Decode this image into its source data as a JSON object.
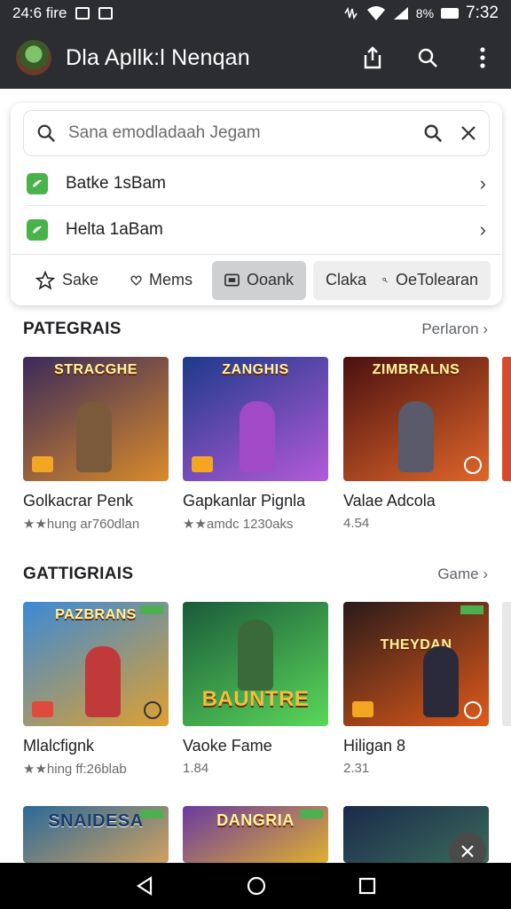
{
  "status_bar": {
    "left_text": "24:6 fire",
    "battery_text": "8%",
    "time": "7:32"
  },
  "app_bar": {
    "title": "Dla Apllk:l Nenqan",
    "icons": [
      "share-icon",
      "search-icon",
      "more-vert-icon"
    ]
  },
  "search": {
    "query": "Sana emodladaah Jegam",
    "suggestions": [
      {
        "label": "Batke 1sBam"
      },
      {
        "label": "Helta 1aBam"
      }
    ],
    "chips": [
      {
        "label": "Sake",
        "icon": "star-icon"
      },
      {
        "label": "Mems",
        "icon": "heart-icon"
      },
      {
        "label": "Ooank",
        "icon": "cast-icon",
        "active": true
      },
      {
        "label": "Claka"
      },
      {
        "label": "OeTolearan",
        "icon": "link-icon"
      }
    ]
  },
  "sections": [
    {
      "title": "PATEGRAIS",
      "link": "Perlaron",
      "items": [
        {
          "banner": "STRACGHE",
          "name": "Golkacrar Penk",
          "meta": "★★hung ar760dlan",
          "colors": [
            "#3a2a5a",
            "#d98a2b"
          ]
        },
        {
          "banner": "ZANGHIS",
          "name": "Gapkanlar Pignla",
          "meta": "★★amdc 1230aks",
          "colors": [
            "#1c3a8a",
            "#b45ad8"
          ]
        },
        {
          "banner": "ZIMBRALNS",
          "name": "Valae Adcola",
          "meta": "4.54",
          "colors": [
            "#4a1010",
            "#e0662a"
          ]
        }
      ]
    },
    {
      "title": "GATTIGRIAIS",
      "link": "Game",
      "items": [
        {
          "banner": "PAZBRANS",
          "name": "Mlalcfignk",
          "meta": "★★hing ff:26blab",
          "colors": [
            "#3a8ad8",
            "#e0a030"
          ]
        },
        {
          "banner": "BAUNTRE",
          "name": "Vaoke Fame",
          "meta": "1.84",
          "colors": [
            "#1a5a3a",
            "#5ad85a"
          ]
        },
        {
          "banner": "THEYDAN",
          "name": "Hiligan 8",
          "meta": "2.31",
          "colors": [
            "#2a1a1a",
            "#e05a1a"
          ]
        }
      ]
    }
  ],
  "third_row": [
    {
      "banner": "SNAIDESA",
      "colors": [
        "#2a6a9a",
        "#d0a060"
      ]
    },
    {
      "banner": "DANGRIA",
      "colors": [
        "#6a3aa0",
        "#e0b030"
      ]
    },
    {
      "banner": "",
      "colors": [
        "#1a2a4a",
        "#3a6a5a"
      ]
    }
  ],
  "nav_bar": {
    "icons": [
      "back-icon",
      "home-icon",
      "recents-icon"
    ]
  }
}
